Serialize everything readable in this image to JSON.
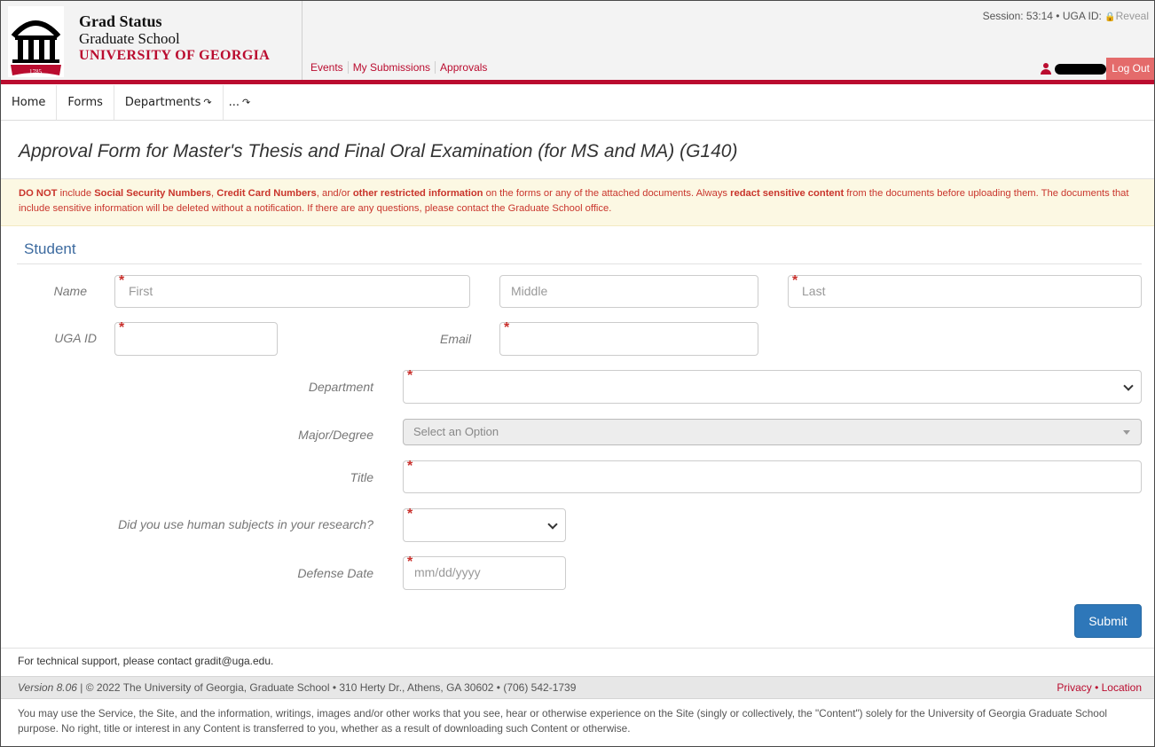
{
  "header": {
    "brand_title": "Grad Status",
    "brand_subtitle": "Graduate School",
    "brand_university": "UNIVERSITY OF GEORGIA",
    "logo_year": "1785",
    "session_text": "Session: 53:14 • UGA ID:",
    "reveal_label": "Reveal",
    "logout_label": "Log Out",
    "accent_color": "#ba0c2f"
  },
  "topnav": [
    "Events",
    "My Submissions",
    "Approvals"
  ],
  "subnav": [
    "Home",
    "Forms",
    "Departments",
    "..."
  ],
  "page_title": "Approval Form for Master's Thesis and Final Oral Examination (for MS and MA) (G140)",
  "warning": {
    "p1": "DO NOT",
    "p2": " include ",
    "p3": "Social Security Numbers",
    "p4": ", ",
    "p5": "Credit Card Numbers",
    "p6": ", and/or ",
    "p7": "other restricted information",
    "p8": " on the forms or any of the attached documents. Always ",
    "p9": "redact sensitive content",
    "p10": " from the documents before uploading them. The documents that include sensitive information will be deleted without a notification. If there are any questions, please contact the Graduate School office."
  },
  "section_title": "Student",
  "labels": {
    "name": "Name",
    "uga_id": "UGA ID",
    "email": "Email",
    "department": "Department",
    "major": "Major/Degree",
    "title": "Title",
    "human_subjects": "Did you use human subjects in your research?",
    "defense_date": "Defense Date"
  },
  "placeholders": {
    "first": "First",
    "middle": "Middle",
    "last": "Last",
    "major": "Select an Option",
    "date": "mm/dd/yyyy"
  },
  "required_mark": "*",
  "submit_label": "Submit",
  "footer": {
    "support": "For technical support, please contact gradit@uga.edu.",
    "version": "Version 8.06",
    "copyright": " | © 2022 The University of Georgia, Graduate School • 310 Herty Dr., Athens, GA 30602 • (706) 542-1739",
    "privacy": "Privacy",
    "sep": " • ",
    "location": "Location",
    "legal": "You may use the Service, the Site, and the information, writings, images and/or other works that you see, hear or otherwise experience on the Site (singly or collectively, the \"Content\") solely for the University of Georgia Graduate School purpose. No right, title or interest in any Content is transferred to you, whether as a result of downloading such Content or otherwise."
  }
}
